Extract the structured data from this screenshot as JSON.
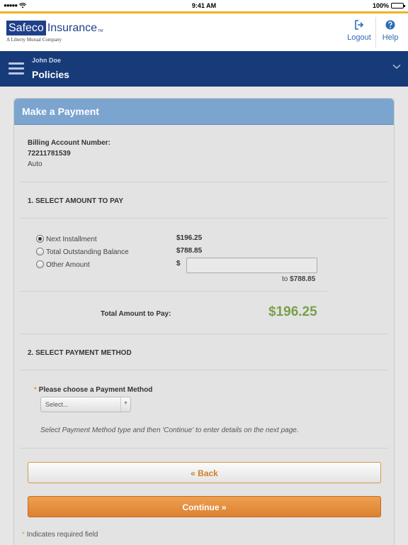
{
  "status_bar": {
    "time": "9:41 AM",
    "battery": "100%",
    "signal_dots": "●●●●●"
  },
  "header": {
    "logo_brand": "Safeco",
    "logo_insurance": "Insurance",
    "logo_tm": "TM",
    "logo_tagline": "A Liberty Mutual Company",
    "logout_label": "Logout",
    "help_label": "Help"
  },
  "nav": {
    "user_name": "John Doe",
    "title": "Policies"
  },
  "payment": {
    "card_title": "Make a Payment",
    "billing_label": "Billing Account Number:",
    "billing_number": "72211781539",
    "billing_type": "Auto",
    "section1_title": "1. SELECT AMOUNT TO PAY",
    "options": [
      {
        "label": "Next Installment",
        "amount": "$196.25",
        "selected": true
      },
      {
        "label": "Total Outstanding Balance",
        "amount": "$788.85",
        "selected": false
      },
      {
        "label": "Other Amount",
        "amount": "$",
        "selected": false
      }
    ],
    "other_amount_max_prefix": "to",
    "other_amount_max": "$788.85",
    "total_label": "Total Amount to Pay:",
    "total_amount": "$196.25",
    "section2_title": "2. SELECT PAYMENT METHOD",
    "required_marker": "*",
    "method_label": "Please choose a Payment Method",
    "method_select_value": "Select...",
    "method_helper": "Select Payment Method type and then 'Continue' to enter details on the next page.",
    "back_label": "« Back",
    "continue_label": "Continue »",
    "required_note": "Indicates required field"
  },
  "colors": {
    "accent_bar": "#f0b323",
    "nav_bg": "#173a79",
    "card_header_bg": "#7ba4cf",
    "total_amount": "#7aa04a",
    "continue_button": "#e38c38",
    "link_blue": "#2a6cb6"
  },
  "icons": {
    "logout": "logout-arrow-icon",
    "help": "question-circle-icon",
    "menu": "hamburger-menu-icon",
    "nav_expand": "chevron-down-icon"
  }
}
